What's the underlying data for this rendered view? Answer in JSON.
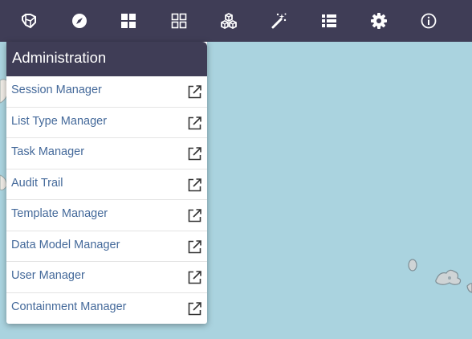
{
  "colors": {
    "toolbar_bg": "#3f3d56",
    "water": "#aad3df",
    "link_text": "#44699a",
    "icon_color": "#ffffff"
  },
  "toolbar": {
    "items": [
      {
        "icon": "layers-cube-icon"
      },
      {
        "icon": "compass-icon"
      },
      {
        "icon": "grid-filled-icon"
      },
      {
        "icon": "grid-outline-icon"
      },
      {
        "icon": "cubes-icon"
      },
      {
        "icon": "magic-wand-icon"
      },
      {
        "icon": "list-icon"
      },
      {
        "icon": "gear-icon"
      },
      {
        "icon": "info-icon"
      }
    ]
  },
  "panel": {
    "title": "Administration",
    "items": [
      {
        "label": "Session Manager",
        "icon": "external-link-icon"
      },
      {
        "label": "List Type Manager",
        "icon": "external-link-icon"
      },
      {
        "label": "Task Manager",
        "icon": "external-link-icon"
      },
      {
        "label": "Audit Trail",
        "icon": "external-link-icon"
      },
      {
        "label": "Template Manager",
        "icon": "external-link-icon"
      },
      {
        "label": "Data Model Manager",
        "icon": "external-link-icon"
      },
      {
        "label": "User Manager",
        "icon": "external-link-icon"
      },
      {
        "label": "Containment Manager",
        "icon": "external-link-icon"
      }
    ]
  }
}
